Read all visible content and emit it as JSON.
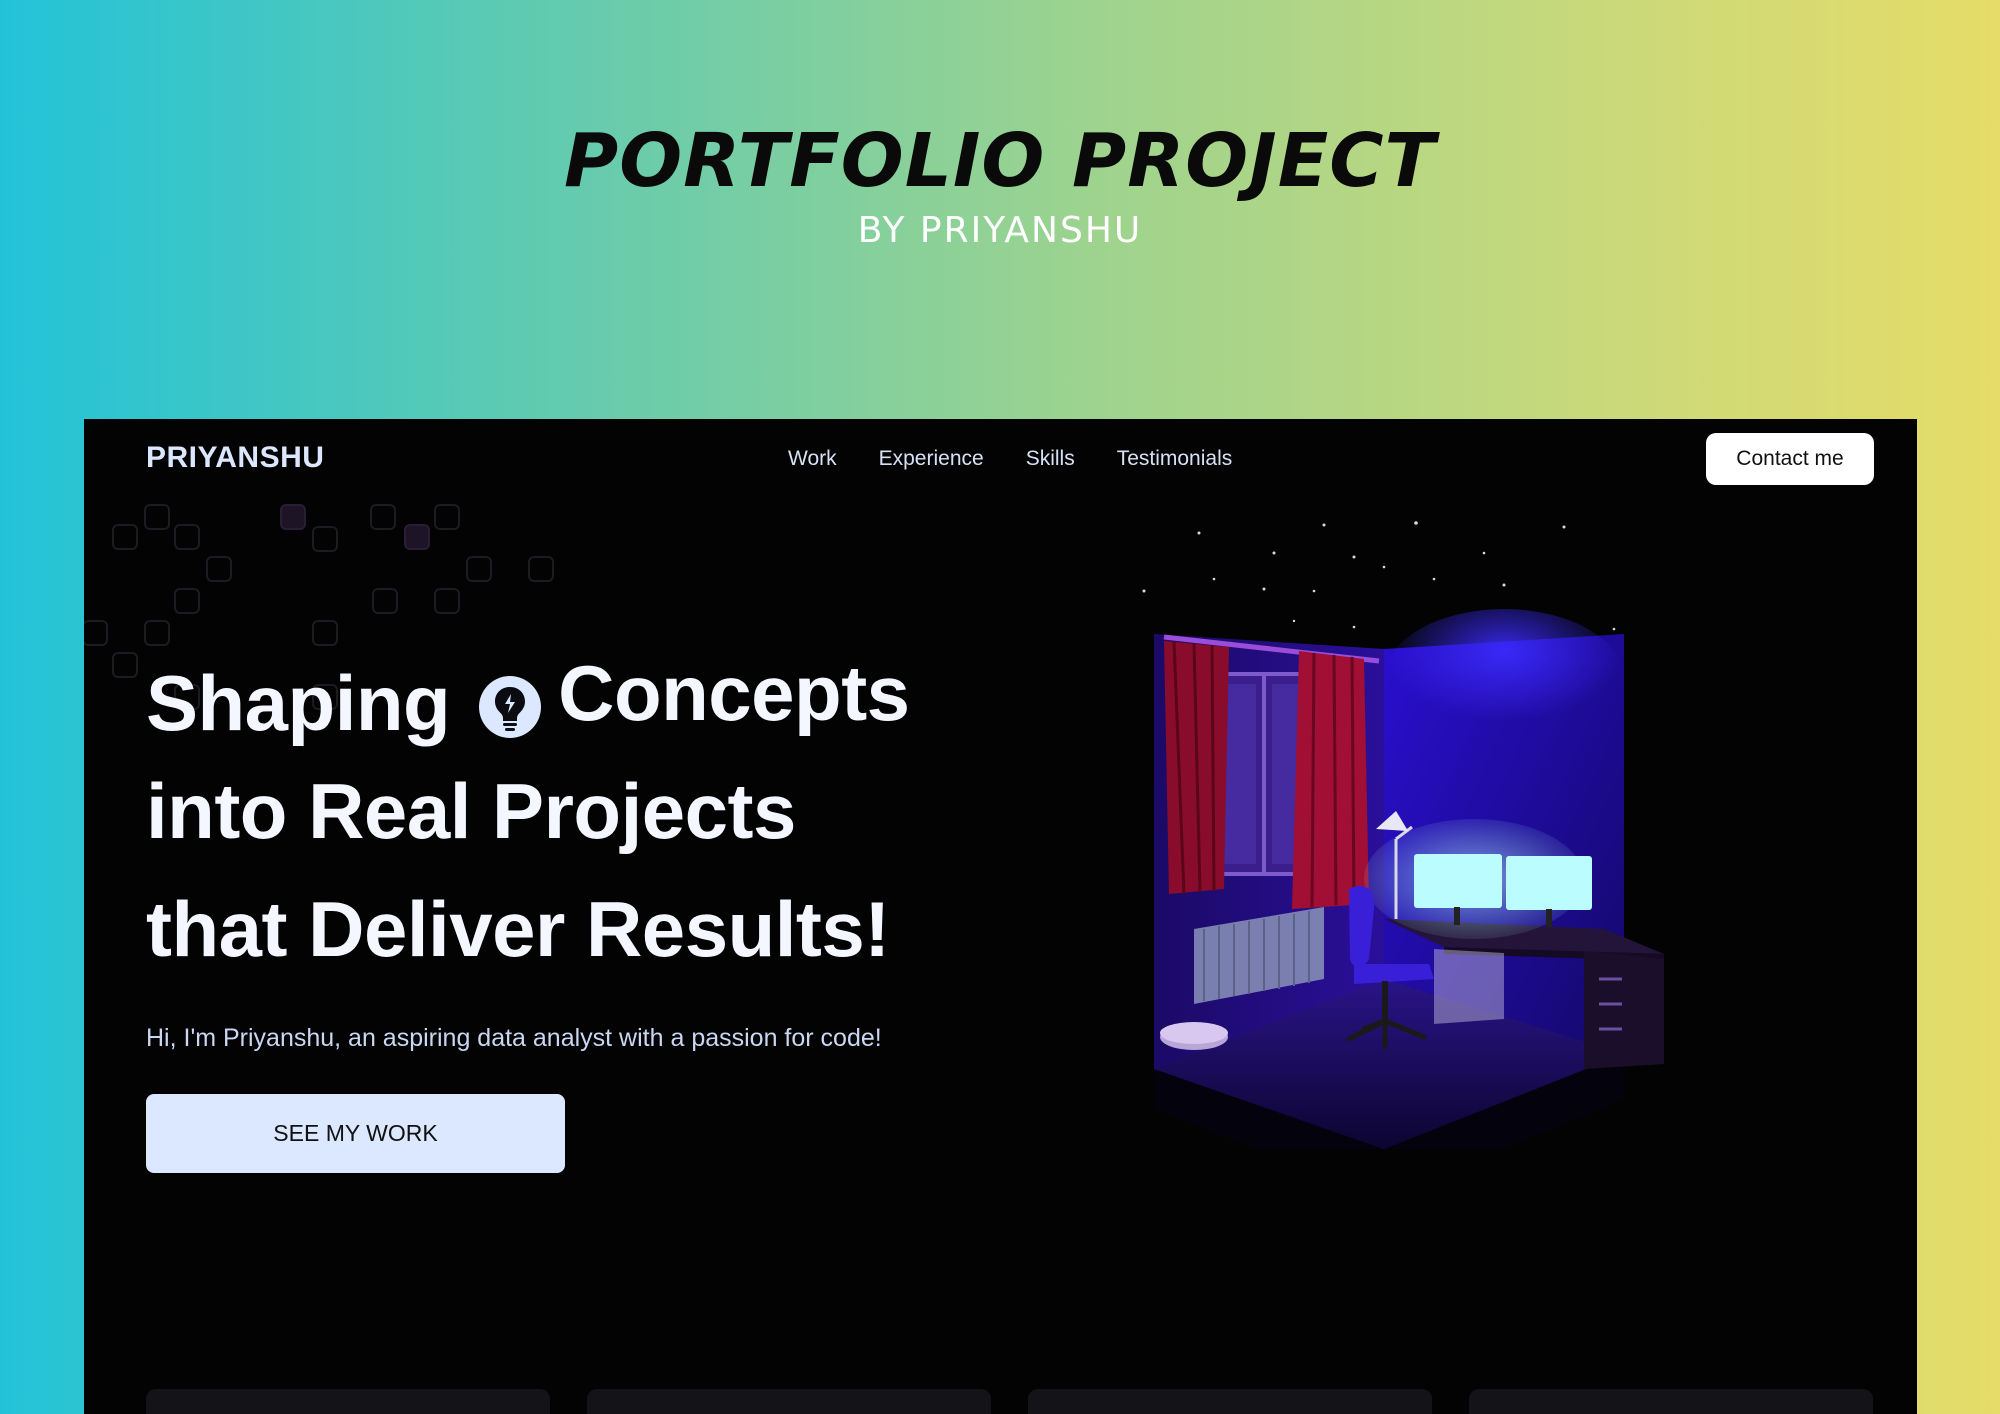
{
  "banner": {
    "title": "PORTFOLIO PROJECT",
    "subtitle": "BY PRIYANSHU"
  },
  "header": {
    "logo": "PRIYANSHU",
    "nav": [
      {
        "label": "Work"
      },
      {
        "label": "Experience"
      },
      {
        "label": "Skills"
      },
      {
        "label": "Testimonials"
      }
    ],
    "contact_label": "Contact me"
  },
  "hero": {
    "line1_a": "Shaping",
    "line1_icon": "lightbulb-icon",
    "line1_b": "Concepts",
    "line2": "into Real Projects",
    "line3": "that Deliver Results!",
    "intro": "Hi, I'm Priyanshu, an aspiring data analyst with a passion for code!",
    "cta_label": "SEE MY WORK"
  },
  "illustration": {
    "icon": "room-3d-illustration"
  },
  "colors": {
    "gradient_start": "#22c3d8",
    "gradient_end": "#e6dc68",
    "frame_bg": "#030303",
    "cta_bg": "#dbe8ff",
    "room_accent": "#2a0fd0",
    "monitor_glow": "#aef7ff"
  }
}
